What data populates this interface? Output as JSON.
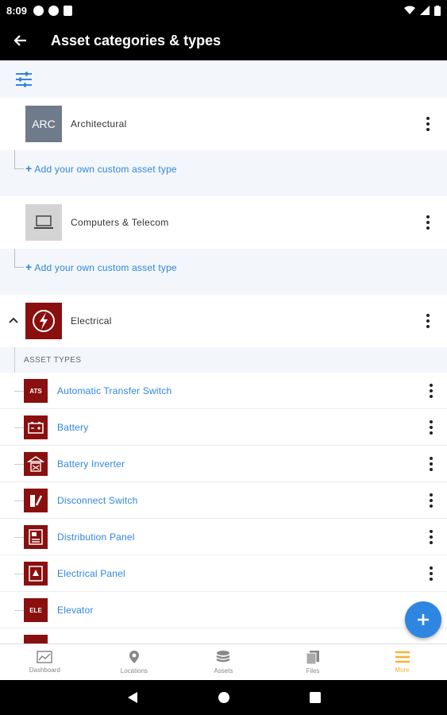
{
  "status_bar": {
    "time": "8:09"
  },
  "app_bar": {
    "title": "Asset categories & types"
  },
  "categories": [
    {
      "thumb_text": "ARC",
      "name": "Architectural",
      "add_label": "Add your own custom asset type",
      "thumb_color": "#6e7b8b"
    },
    {
      "thumb_text": "",
      "name": "Computers & Telecom",
      "add_label": "Add your own custom asset type",
      "thumb_color": "#d4d4d4"
    },
    {
      "thumb_text": "",
      "name": "Electrical",
      "thumb_color": "#8a0f0f"
    }
  ],
  "types_header": "ASSET TYPES",
  "asset_types": [
    {
      "name": "Automatic Transfer Switch",
      "icon_text": "ATS"
    },
    {
      "name": "Battery",
      "icon_text": ""
    },
    {
      "name": "Battery Inverter",
      "icon_text": ""
    },
    {
      "name": "Disconnect Switch",
      "icon_text": ""
    },
    {
      "name": "Distribution Panel",
      "icon_text": ""
    },
    {
      "name": "Electrical Panel",
      "icon_text": ""
    },
    {
      "name": "Elevator",
      "icon_text": "ELE"
    }
  ],
  "bottom_nav": [
    {
      "label": "Dashboard",
      "icon": "chart-icon"
    },
    {
      "label": "Locations",
      "icon": "location-pin-icon"
    },
    {
      "label": "Assets",
      "icon": "database-icon"
    },
    {
      "label": "Files",
      "icon": "files-icon"
    },
    {
      "label": "More",
      "icon": "menu-icon",
      "active": true
    }
  ],
  "colors": {
    "accent": "#2f86e0",
    "active_nav": "#f5b335",
    "electrical": "#8a0f0f"
  }
}
